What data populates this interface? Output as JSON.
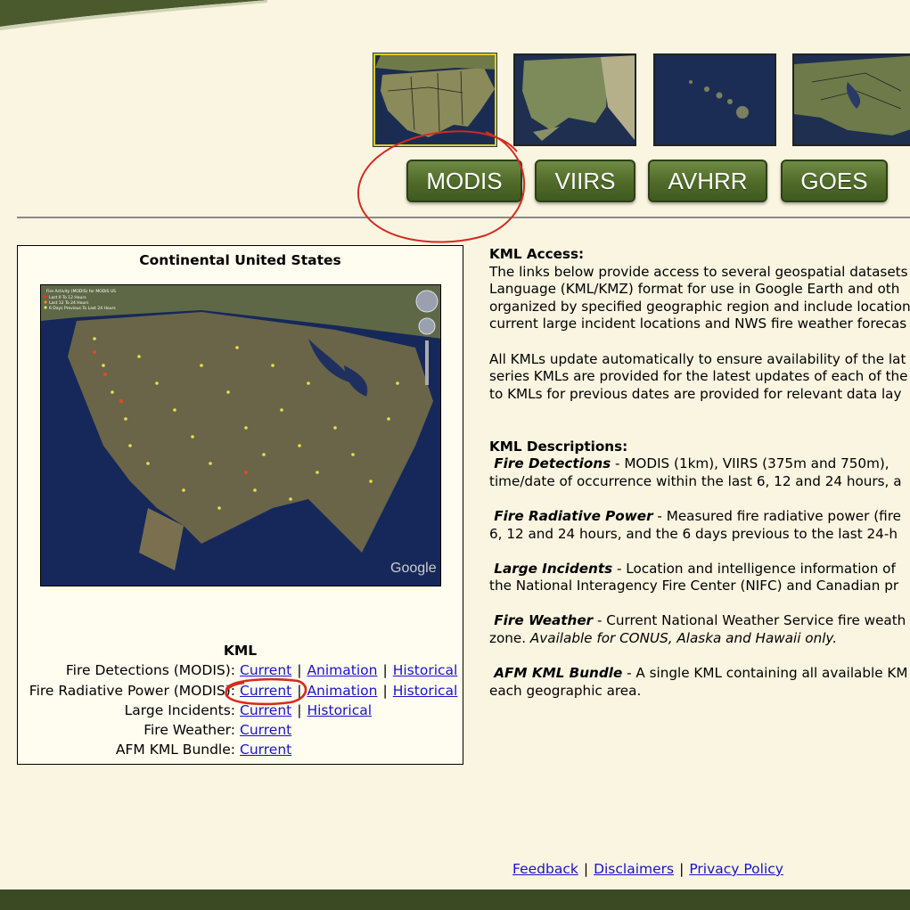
{
  "thumbnails": [
    {
      "region": "conus",
      "selected": true
    },
    {
      "region": "alaska",
      "selected": false
    },
    {
      "region": "hawaii",
      "selected": false
    },
    {
      "region": "canada",
      "selected": false
    }
  ],
  "sensor_buttons": [
    "MODIS",
    "VIIRS",
    "AVHRR",
    "GOES"
  ],
  "panel": {
    "title": "Continental United States",
    "map_legend": [
      "Fire Activity (MODIS) for MODIS US",
      "Last 0 To 12 Hours",
      "Last 12 To 24 Hours",
      "6 Days Previous To Last 24 Hours"
    ],
    "map_watermark": "Google",
    "kml_title": "KML",
    "rows": [
      {
        "label": "Fire Detections (MODIS):",
        "links": [
          "Current",
          "Animation",
          "Historical"
        ]
      },
      {
        "label": "Fire Radiative Power (MODIS):",
        "links": [
          "Current",
          "Animation",
          "Historical"
        ]
      },
      {
        "label": "Large Incidents:",
        "links": [
          "Current",
          "Historical"
        ]
      },
      {
        "label": "Fire Weather:",
        "links": [
          "Current"
        ]
      },
      {
        "label": "AFM KML Bundle:",
        "links": [
          "Current"
        ]
      }
    ]
  },
  "kml_access": {
    "heading": "KML Access:",
    "p1": [
      "The links below provide access to several geospatial datasets",
      "Language (KML/KMZ) format for use in Google Earth and oth",
      "organized by specified geographic region and include location",
      "current large incident locations and NWS fire weather forecas"
    ],
    "p2": [
      "All KMLs update automatically to ensure availability of the lat",
      "series KMLs are provided for the latest updates of each of the",
      "to KMLs for previous dates are provided for relevant data lay"
    ]
  },
  "kml_descriptions": {
    "heading": "KML Descriptions:",
    "items": [
      {
        "term": "Fire Detections",
        "lines": [
          " - MODIS (1km), VIIRS (375m and 750m),",
          "time/date of occurrence within the last 6, 12 and 24 hours, a"
        ]
      },
      {
        "term": "Fire Radiative Power",
        "lines": [
          " - Measured fire radiative power (fire",
          "6, 12 and 24 hours, and the 6 days previous to the last 24-h"
        ]
      },
      {
        "term": "Large Incidents",
        "lines": [
          " - Location and intelligence information of",
          "the National Interagency Fire Center (NIFC) and Canadian pr"
        ]
      },
      {
        "term": "Fire Weather",
        "lines": [
          " - Current National Weather Service fire weath",
          "zone. "
        ],
        "italic_tail": "Available for CONUS, Alaska and Hawaii only."
      },
      {
        "term": "AFM KML Bundle",
        "lines": [
          " - A single KML containing all available KM",
          "each geographic area."
        ]
      }
    ]
  },
  "footer": {
    "links": [
      "Feedback",
      "Disclaimers",
      "Privacy Policy"
    ],
    "separator": "|"
  },
  "colors": {
    "background": "#faf5e1",
    "button_green": "#4f6a28",
    "link": "#1a12c7",
    "annotation_red": "#d42a22",
    "bottom_bar": "#3b4a22"
  }
}
